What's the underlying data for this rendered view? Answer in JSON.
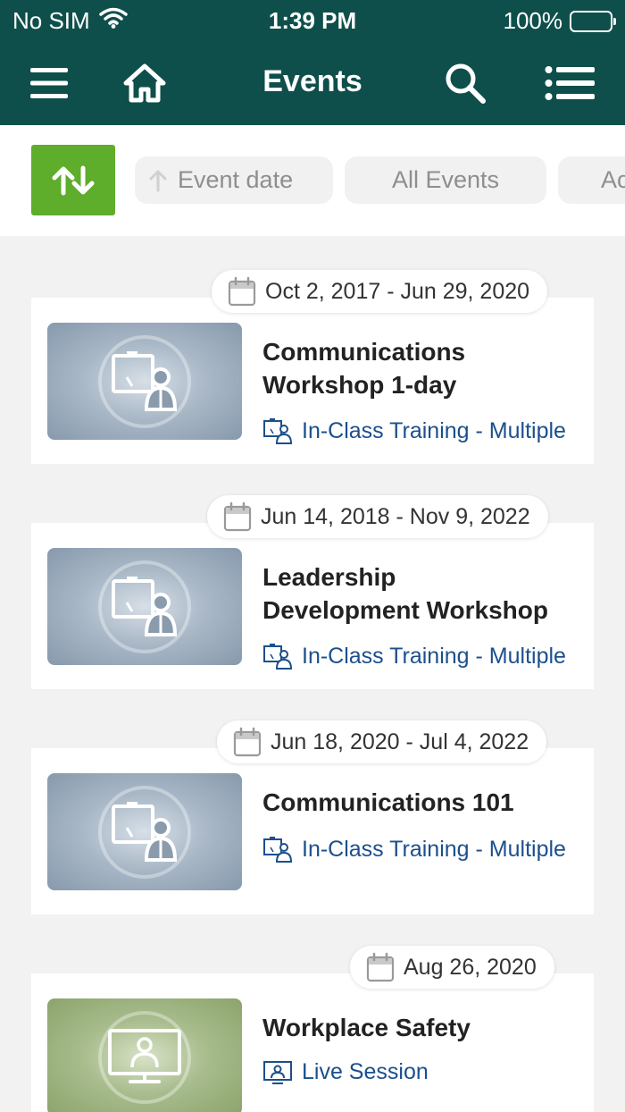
{
  "status": {
    "carrier": "No SIM",
    "time": "1:39 PM",
    "battery": "100%"
  },
  "nav": {
    "title": "Events"
  },
  "filters": {
    "sort_field": "Event date",
    "category": "All Events",
    "next_chip": "Ac"
  },
  "events": [
    {
      "date": "Oct 2, 2017 - Jun 29, 2020",
      "title_line1": "Communications",
      "title_line2": "Workshop 1-day",
      "type": "In-Class Training - Multiple",
      "thumb_icon": "classroom-icon"
    },
    {
      "date": "Jun 14, 2018 - Nov 9, 2022",
      "title_line1": "Leadership",
      "title_line2": "Development Workshop",
      "type": "In-Class Training - Multiple",
      "thumb_icon": "classroom-icon"
    },
    {
      "date": "Jun 18, 2020 - Jul 4, 2022",
      "title_line1": "Communications 101",
      "title_line2": "",
      "type": "In-Class Training - Multiple",
      "thumb_icon": "classroom-icon"
    },
    {
      "date": "Aug 26, 2020",
      "title_line1": "Workplace Safety",
      "title_line2": "",
      "type": "Live Session",
      "thumb_icon": "live-session-icon"
    }
  ],
  "colors": {
    "header": "#0e4f4b",
    "sort_button": "#5ead2b",
    "link": "#1c4f8c"
  }
}
